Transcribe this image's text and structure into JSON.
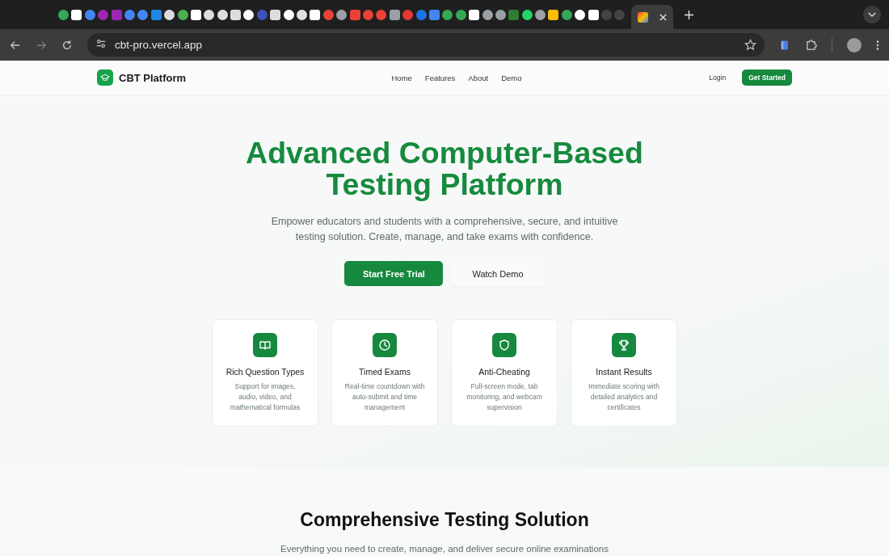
{
  "browser": {
    "url": "cbt-pro.vercel.app"
  },
  "nav": {
    "brand": "CBT Platform",
    "links": [
      {
        "label": "Home"
      },
      {
        "label": "Features"
      },
      {
        "label": "About"
      },
      {
        "label": "Demo"
      }
    ],
    "login": "Login",
    "cta": "Get Started"
  },
  "hero": {
    "title_lines": [
      "Advanced Computer-Based",
      "Testing Platform"
    ],
    "subtitle": "Empower educators and students with a comprehensive, secure, and intuitive testing solution. Create, manage, and take exams with confidence.",
    "buttons": [
      {
        "label": "Start Free Trial",
        "kind": "primary"
      },
      {
        "label": "Watch Demo",
        "kind": "secondary"
      }
    ]
  },
  "features": [
    {
      "kind": "book",
      "title": "Rich Question Types",
      "description": "Support for images, audio, video, and mathematical formulas"
    },
    {
      "kind": "clock",
      "title": "Timed Exams",
      "description": "Real-time countdown with auto-submit and time management"
    },
    {
      "kind": "shield",
      "title": "Anti-Cheating",
      "description": "Full-screen mode, tab monitoring, and webcam supervision"
    },
    {
      "kind": "trophy",
      "title": "Instant Results",
      "description": "Immediate scoring with detailed analytics and certificates"
    }
  ],
  "section": {
    "title": "Comprehensive Testing Solution",
    "subtitle": "Everything you need to create, manage, and deliver secure online examinations"
  }
}
